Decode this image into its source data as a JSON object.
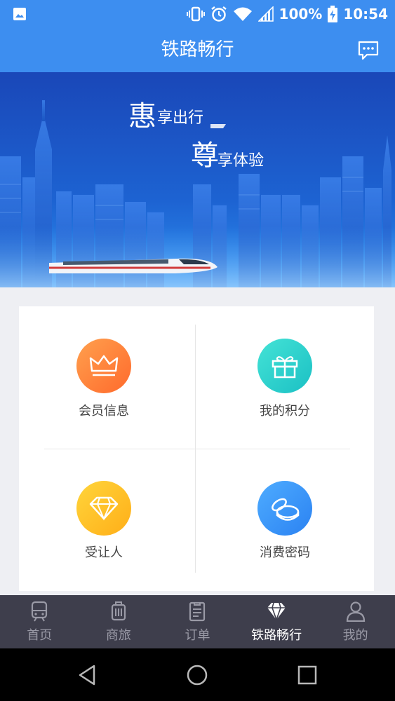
{
  "status_bar": {
    "battery": "100%",
    "time": "10:54",
    "icons": [
      "image-icon",
      "vibrate-icon",
      "alarm-icon",
      "wifi-icon",
      "signal-icon",
      "battery-charging-icon"
    ]
  },
  "header": {
    "title": "铁路畅行",
    "message_icon": "message-icon"
  },
  "banner": {
    "line1_big": "惠",
    "line1_small": "享出行",
    "line2_big": "尊",
    "line2_small": "享体验"
  },
  "menu": {
    "items": [
      {
        "label": "会员信息",
        "icon": "crown-icon",
        "color_from": "#ff9a4a",
        "color_to": "#ff6a2c"
      },
      {
        "label": "我的积分",
        "icon": "gift-icon",
        "color_from": "#3fe0d2",
        "color_to": "#1dc4c6"
      },
      {
        "label": "受让人",
        "icon": "diamond-icon",
        "color_from": "#ffd53b",
        "color_to": "#ffb01a"
      },
      {
        "label": "消费密码",
        "icon": "coins-icon",
        "color_from": "#4aa9ff",
        "color_to": "#2d85f3"
      }
    ]
  },
  "tabs": [
    {
      "label": "首页",
      "icon": "train-icon",
      "active": false
    },
    {
      "label": "商旅",
      "icon": "luggage-icon",
      "active": false
    },
    {
      "label": "订单",
      "icon": "clipboard-icon",
      "active": false
    },
    {
      "label": "铁路畅行",
      "icon": "diamond-icon",
      "active": true
    },
    {
      "label": "我的",
      "icon": "person-icon",
      "active": false
    }
  ],
  "colors": {
    "brand_blue": "#3d8ef0",
    "tab_bar": "#3e3e4c",
    "page_bg": "#eeeff3"
  }
}
